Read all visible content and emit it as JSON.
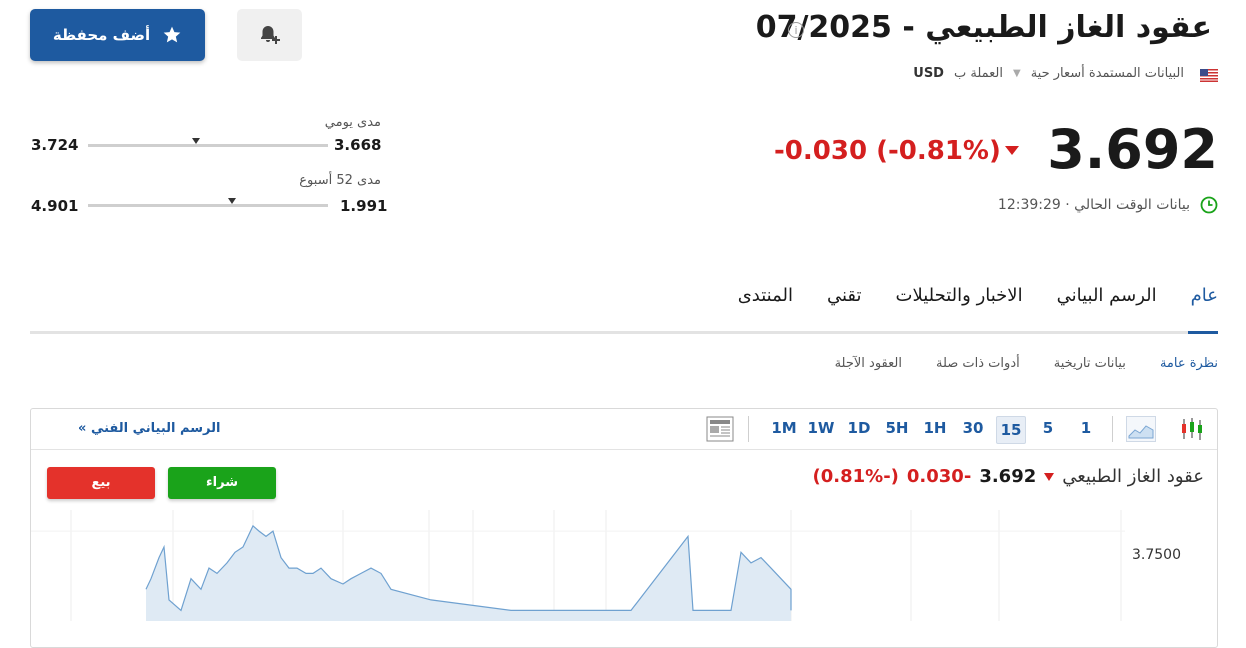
{
  "header": {
    "title": "عقود الغاز الطبيعي - 07/2025",
    "add_portfolio_label": "أضف محفظة",
    "data_source": "البيانات المستمدة أسعار حية",
    "currency_prefix": "العملة ب",
    "currency": "USD"
  },
  "quote": {
    "price": "3.692",
    "change": "-0.030",
    "change_pct": "(-0.81%)",
    "time": "12:39:29",
    "time_label": "بيانات الوقت الحالي ·"
  },
  "ranges": {
    "daily": {
      "label": "مدى يومي",
      "low": "3.668",
      "high": "3.724",
      "position": 0.55
    },
    "week52": {
      "label": "مدى 52 أسبوع",
      "low": "1.991",
      "high": "4.901",
      "position": 0.4
    }
  },
  "tabs": [
    "عام",
    "الرسم البياني",
    "الاخبار والتحليلات",
    "تقني",
    "المنتدى"
  ],
  "subtabs": [
    "نظرة عامة",
    "بيانات تاريخية",
    "أدوات ذات صلة",
    "العقود الآجلة"
  ],
  "chart": {
    "timeframes": [
      "1",
      "5",
      "15",
      "30",
      "1H",
      "5H",
      "1D",
      "1W",
      "1M"
    ],
    "active_timeframe": "15",
    "tech_link": "الرسم البياني الفني",
    "tech_link_arrow": "»",
    "buy_label": "شراء",
    "sell_label": "بيع",
    "name": "عقود الغاز الطبيعي",
    "price": "3.692",
    "change": "-0.030",
    "change_pct": "(-0.81%)",
    "y_tick": "3.7500"
  },
  "chart_data": {
    "type": "area",
    "y_ticks": [
      "3.7500"
    ],
    "series": [
      {
        "values": [
          3.64,
          3.66,
          3.7,
          3.72,
          3.62,
          3.6,
          3.66,
          3.64,
          3.68,
          3.67,
          3.69,
          3.71,
          3.72,
          3.76,
          3.75,
          3.74,
          3.75,
          3.7,
          3.68,
          3.68,
          3.67,
          3.67,
          3.68,
          3.66,
          3.65,
          3.66,
          3.67,
          3.68,
          3.67,
          3.64,
          3.62,
          3.6,
          3.6,
          3.6,
          3.6,
          3.6,
          3.74,
          3.6,
          3.6,
          3.6,
          3.6,
          3.71,
          3.69,
          3.7,
          3.68,
          3.66,
          3.64,
          3.6
        ]
      }
    ]
  },
  "colors": {
    "accent": "#1e5aa0",
    "down": "#d41f1f",
    "buy": "#1aa31a",
    "sell": "#e4322b"
  }
}
